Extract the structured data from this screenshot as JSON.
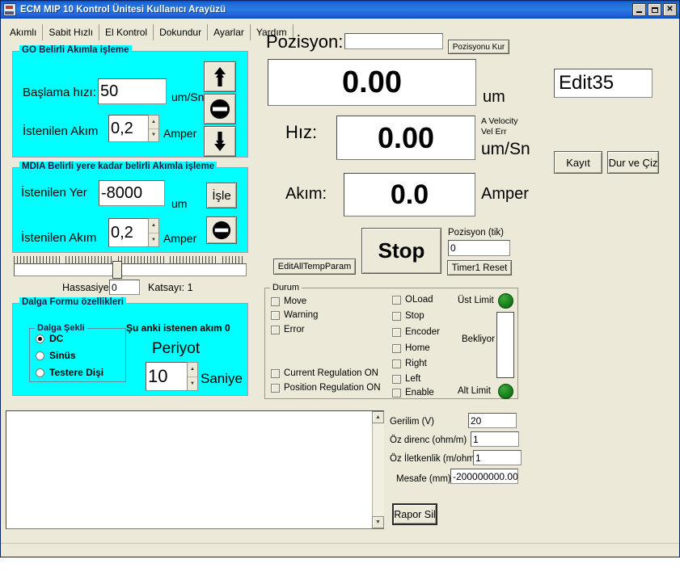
{
  "window": {
    "title": "ECM MIP 10 Kontrol Ünitesi Kullanıcı Arayüzü",
    "minimize": "–",
    "maximize": "□",
    "close": "✕"
  },
  "tabs": [
    {
      "label": "Akımlı",
      "active": true
    },
    {
      "label": "Sabit Hızlı",
      "active": false
    },
    {
      "label": "El Kontrol",
      "active": false
    },
    {
      "label": "Dokundur",
      "active": false
    },
    {
      "label": "Ayarlar",
      "active": false
    },
    {
      "label": "Yardım",
      "active": false
    }
  ],
  "go_group": {
    "title": "GO Belirli Akımla işleme",
    "start_speed_label": "Başlama hızı:",
    "start_speed_value": "50",
    "start_speed_unit": "um/Sn",
    "current_label": "İstenilen Akım",
    "current_value": "0,2",
    "current_unit": "Amper",
    "btn_up": "up-double-arrow",
    "btn_stop": "stop-circle",
    "btn_down": "down-double-arrow"
  },
  "mdia_group": {
    "title": "MDIA Belirli yere kadar belirli  Akımla işleme",
    "target_label": "İstenilen Yer",
    "target_value": "-8000",
    "target_unit": "um",
    "current_label": "İstenilen Akım",
    "current_value": "0,2",
    "current_unit": "Amper",
    "run_button": "İşle",
    "stop_button": "stop-circle"
  },
  "slider": {
    "sensitivity_label": "Hassasiye",
    "sensitivity_value": "0",
    "coefficient_label": "Katsayı: 1"
  },
  "wave_group": {
    "title": "Dalga Formu özellikleri",
    "shape_title": "Dalga Şekli",
    "options": [
      {
        "label": "DC",
        "selected": true
      },
      {
        "label": "Sinüs",
        "selected": false
      },
      {
        "label": "Testere Dişi",
        "selected": false
      }
    ],
    "current_info": "Şu anki istenen akım 0",
    "period_label": "Periyot",
    "period_value": "10",
    "period_unit": "Saniye"
  },
  "readouts": {
    "position_label": "Pozisyon:",
    "position_input_value": "",
    "set_position_button": "Pozisyonu Kur",
    "position_value": "0.00",
    "position_unit": "um",
    "speed_label": "Hız:",
    "speed_value": "0.00",
    "speed_note1": "A Velocity",
    "speed_note2": "Vel Err",
    "speed_unit": "um/Sn",
    "current_label": "Akım:",
    "current_value": "0.0",
    "current_unit": "Amper",
    "edit35_value": "Edit35",
    "save_button": "Kayıt",
    "stop_draw_button": "Dur ve Çiz"
  },
  "controls": {
    "edit_all_temp_param": "EditAllTempParam",
    "stop_button": "Stop",
    "position_tick_label": "Pozisyon (tik)",
    "position_tick_value": "0",
    "timer_reset_button": "Timer1 Reset"
  },
  "status": {
    "title": "Durum",
    "col1": [
      {
        "label": "Move",
        "checked": false
      },
      {
        "label": "Warning",
        "checked": false
      },
      {
        "label": "Error",
        "checked": false
      }
    ],
    "col1b": [
      {
        "label": "Current Regulation ON",
        "checked": false
      },
      {
        "label": "Position Regulation ON",
        "checked": false
      }
    ],
    "col2": [
      {
        "label": "OLoad",
        "checked": false
      },
      {
        "label": "Stop",
        "checked": false
      },
      {
        "label": "Encoder",
        "checked": false
      },
      {
        "label": "Home",
        "checked": false
      },
      {
        "label": "Right",
        "checked": false
      },
      {
        "label": "Left",
        "checked": false
      },
      {
        "label": "Enable",
        "checked": false
      }
    ],
    "upper_limit_label": "Üst Limit",
    "lower_limit_label": "Alt Limit",
    "wait_label": "Bekliyor",
    "led_color": "#1f8a1f"
  },
  "params": {
    "rows": [
      {
        "label": "Gerilim (V)",
        "value": "20"
      },
      {
        "label": "Öz direnc (ohm/m)",
        "value": "1"
      },
      {
        "label": "Öz İletkenlik (m/ohm)",
        "value": "1"
      },
      {
        "label": "Mesafe (mm)",
        "value": "-200000000.000"
      }
    ],
    "clear_report_button": "Rapor Sil"
  },
  "report_list": {
    "content": "",
    "scroll_up": "▲",
    "scroll_down": "▼"
  }
}
